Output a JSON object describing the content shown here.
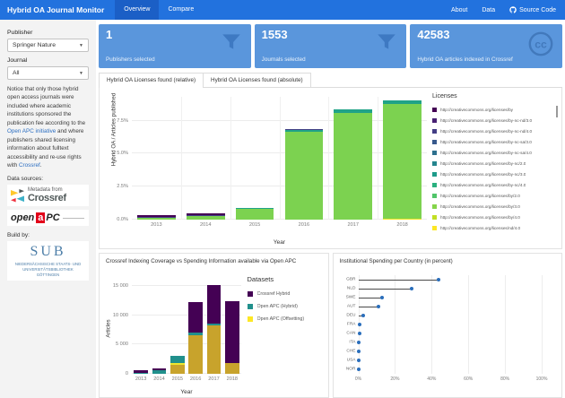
{
  "navbar": {
    "brand": "Hybrid OA Journal Monitor",
    "tabs": [
      {
        "label": "Overview",
        "active": true
      },
      {
        "label": "Compare",
        "active": false
      }
    ],
    "links": [
      {
        "label": "About"
      },
      {
        "label": "Data"
      },
      {
        "label": "Source Code",
        "icon": "github-icon"
      }
    ],
    "colors": {
      "bar": "#2272DE",
      "active_tab": "#1B5FC6"
    }
  },
  "sidebar": {
    "publisher_label": "Publisher",
    "publisher_value": "Springer Nature",
    "journal_label": "Journal",
    "journal_value": "All",
    "notice": {
      "pre": "Notice that only those hybrid open access journals were included where academic institutions sponsored the publication fee according to the ",
      "link1": "Open APC initiative",
      "mid": " and where publishers shared licensing information about fulltext accessibility and re-use rights with ",
      "link2": "Crossref",
      "post": "."
    },
    "data_sources_label": "Data sources:",
    "crossref_logo": {
      "line1": "Metadata from",
      "line2": "Crossref"
    },
    "openapc_logo": {
      "open": "open",
      "a": "a",
      "pc": "PC"
    },
    "build_by_label": "Build by:",
    "sub_logo": {
      "text": "SUB",
      "caption1": "NIEDERSÄCHSISCHE STAATS- UND",
      "caption2": "UNIVERSITÄTSBIBLIOTHEK GÖTTINGEN"
    }
  },
  "stats": [
    {
      "value": "1",
      "label": "Publishers selected",
      "icon": "filter-icon"
    },
    {
      "value": "1553",
      "label": "Journals selected",
      "icon": "filter-icon"
    },
    {
      "value": "42583",
      "label": "Hybrid OA articles indexed in Crossref",
      "icon": "creative-commons-icon"
    }
  ],
  "license_tabs": [
    {
      "label": "Hybrid OA Licenses found (relative)",
      "active": true
    },
    {
      "label": "Hybrid OA Licenses found (absolute)",
      "active": false
    }
  ],
  "chart_data": [
    {
      "type": "bar",
      "stacked": true,
      "xlabel": "Year",
      "ylabel": "Hybrid OA / Articles published",
      "categories": [
        "2013",
        "2014",
        "2015",
        "2016",
        "2017",
        "2018"
      ],
      "ylim": [
        0,
        9.3
      ],
      "yticks": [
        {
          "value": 0,
          "label": "0.0%"
        },
        {
          "value": 2.5,
          "label": "2.5%"
        },
        {
          "value": 5,
          "label": "5.0%"
        },
        {
          "value": 7.5,
          "label": "7.5%"
        }
      ],
      "legend_title": "Licenses",
      "legend": [
        {
          "label": "http://creativecommons.org/licenses/by",
          "color": "#440154"
        },
        {
          "label": "http://creativecommons.org/licenses/by-nc-nd/3.0",
          "color": "#482173"
        },
        {
          "label": "http://creativecommons.org/licenses/by-nc-nd/4.0",
          "color": "#433E85"
        },
        {
          "label": "http://creativecommons.org/licenses/by-nc-sa/3.0",
          "color": "#38598C"
        },
        {
          "label": "http://creativecommons.org/licenses/by-nc-sa/4.0",
          "color": "#2D708E"
        },
        {
          "label": "http://creativecommons.org/licenses/by-nc/2.0",
          "color": "#25858E"
        },
        {
          "label": "http://creativecommons.org/licenses/by-nc/3.0",
          "color": "#1E9B8A"
        },
        {
          "label": "http://creativecommons.org/licenses/by-nc/4.0",
          "color": "#2AB07F"
        },
        {
          "label": "http://creativecommons.org/licenses/by/2.0",
          "color": "#51C56A"
        },
        {
          "label": "http://creativecommons.org/licenses/by/3.0",
          "color": "#85D54A"
        },
        {
          "label": "http://creativecommons.org/licenses/by/4.0",
          "color": "#C2DF23"
        },
        {
          "label": "http://creativecommons.org/licenses/nd/4.0",
          "color": "#FDE725"
        }
      ],
      "bars": [
        [
          {
            "name": "by/3.0",
            "color": "#7CD250",
            "value": 0.14
          },
          {
            "name": "by-nc-nd/4.0",
            "color": "#433E85",
            "value": 0.04
          },
          {
            "name": "by",
            "color": "#440154",
            "value": 0.13
          }
        ],
        [
          {
            "name": "by/3.0",
            "color": "#7CD250",
            "value": 0.3
          },
          {
            "name": "by-nc-nd/4.0",
            "color": "#433E85",
            "value": 0.05
          },
          {
            "name": "by",
            "color": "#440154",
            "value": 0.12
          }
        ],
        [
          {
            "name": "by/3.0",
            "color": "#7CD250",
            "value": 0.83
          },
          {
            "name": "by-nc/4.0",
            "color": "#20A387",
            "value": 0.06
          }
        ],
        [
          {
            "name": "by/3.0",
            "color": "#7CD250",
            "value": 6.68
          },
          {
            "name": "by-nc/4.0",
            "color": "#20A387",
            "value": 0.12
          },
          {
            "name": "by-nc-nd/4.0",
            "color": "#433E85",
            "value": 0.07
          }
        ],
        [
          {
            "name": "by/3.0",
            "color": "#7CD250",
            "value": 8.05
          },
          {
            "name": "by-nc/4.0",
            "color": "#20A387",
            "value": 0.3
          }
        ],
        [
          {
            "name": "nd/4.0",
            "color": "#FDE725",
            "value": 0.05
          },
          {
            "name": "by/3.0",
            "color": "#7CD250",
            "value": 8.7
          },
          {
            "name": "by-nc/4.0",
            "color": "#20A387",
            "value": 0.26
          }
        ]
      ]
    },
    {
      "type": "bar",
      "stacked": true,
      "title": "Crossref Indexing Coverage vs Spending Information available via Open APC",
      "xlabel": "Year",
      "ylabel": "Articles",
      "categories": [
        "2013",
        "2014",
        "2015",
        "2016",
        "2017",
        "2018"
      ],
      "ylim": [
        0,
        16200
      ],
      "yticks": [
        {
          "value": 0,
          "label": "0"
        },
        {
          "value": 5000,
          "label": "5 000"
        },
        {
          "value": 10000,
          "label": "10 000"
        },
        {
          "value": 15000,
          "label": "15 000"
        }
      ],
      "legend_title": "Datasets",
      "legend": [
        {
          "label": "Crossref Hybrid",
          "color": "#440154"
        },
        {
          "label": "Open APC (Hybrid)",
          "color": "#21908C"
        },
        {
          "label": "Open APC (Offsetting)",
          "color": "#FDE725"
        }
      ],
      "bars": [
        [
          {
            "name": "Open APC (Hybrid)",
            "color": "#21908C",
            "value": 150
          },
          {
            "name": "Crossref Hybrid",
            "color": "#440154",
            "value": 400
          }
        ],
        [
          {
            "name": "Open APC (Hybrid)",
            "color": "#21908C",
            "value": 650
          },
          {
            "name": "Crossref Hybrid",
            "color": "#440154",
            "value": 250
          }
        ],
        [
          {
            "name": "Open APC (Offsetting)",
            "color": "#C8A32C",
            "value": 1500
          },
          {
            "name": "Open APC (Offsetting)",
            "color": "#EDE72F",
            "value": 350
          },
          {
            "name": "Open APC (Hybrid)",
            "color": "#21908C",
            "value": 1150
          }
        ],
        [
          {
            "name": "Open APC (Offsetting)",
            "color": "#C8A32C",
            "value": 6600
          },
          {
            "name": "Open APC (Hybrid)",
            "color": "#21908C",
            "value": 400
          },
          {
            "name": "Crossref Hybrid",
            "color": "#440154",
            "value": 5200
          }
        ],
        [
          {
            "name": "Open APC (Offsetting)",
            "color": "#C8A32C",
            "value": 8300
          },
          {
            "name": "Open APC (Hybrid)",
            "color": "#21908C",
            "value": 300
          },
          {
            "name": "Crossref Hybrid",
            "color": "#440154",
            "value": 6500
          }
        ],
        [
          {
            "name": "Open APC (Offsetting)",
            "color": "#C8A32C",
            "value": 1800
          },
          {
            "name": "Crossref Hybrid",
            "color": "#440154",
            "value": 10600
          }
        ]
      ]
    },
    {
      "type": "scatter",
      "subtype": "lollipop",
      "title": "Institutional Spending per Country (in percent)",
      "categories": [
        "GBR",
        "NLD",
        "SWE",
        "AUT",
        "DEU",
        "FRA",
        "CAN",
        "ITA",
        "CHE",
        "USA",
        "NOR"
      ],
      "values": [
        44,
        29,
        13,
        11,
        2.5,
        0.5,
        0.5,
        0.4,
        0.4,
        0.4,
        0.3
      ],
      "xlim": [
        0,
        100
      ],
      "xticks": [
        {
          "value": 0,
          "label": "0%"
        },
        {
          "value": 20,
          "label": "20%"
        },
        {
          "value": 40,
          "label": "40%"
        },
        {
          "value": 60,
          "label": "60%"
        },
        {
          "value": 80,
          "label": "80%"
        },
        {
          "value": 100,
          "label": "100%"
        }
      ],
      "dot_color": "#2A6EBB"
    }
  ]
}
